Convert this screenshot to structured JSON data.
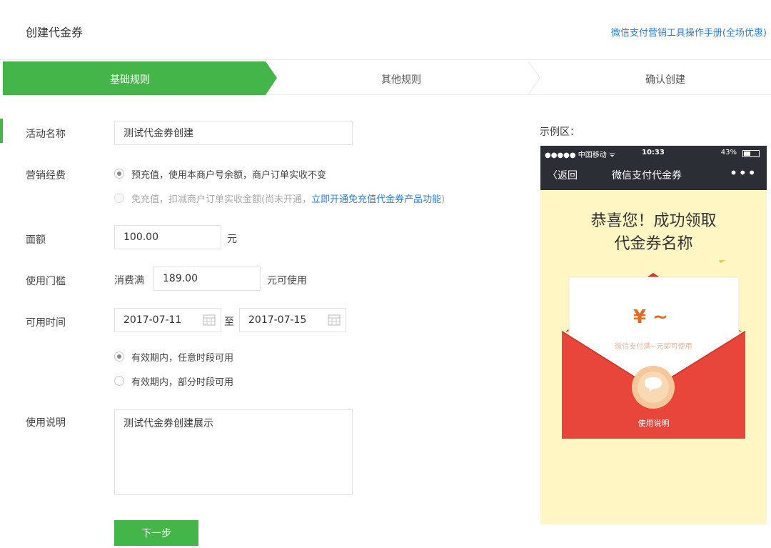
{
  "header": {
    "title": "创建代金券",
    "manual_link": "微信支付营销工具操作手册(全场优惠)"
  },
  "steps": [
    {
      "label": "基础规则",
      "active": true
    },
    {
      "label": "其他规则",
      "active": false
    },
    {
      "label": "确认创建",
      "active": false
    }
  ],
  "form": {
    "activity_name": {
      "label": "活动名称",
      "value": "测试代金券创建"
    },
    "marketing_fee": {
      "label": "营销经费",
      "option1": "预充值，使用本商户号余额，商户订单实收不变",
      "option2_prefix": "免充值，扣减商户订单实收金额(尚未开通，",
      "option2_link": "立即开通免充值代金券产品功能",
      "option2_suffix": ")"
    },
    "face_value": {
      "label": "面额",
      "value": "100.00",
      "unit": "元"
    },
    "threshold": {
      "label": "使用门槛",
      "prefix": "消费满",
      "value": "189.00",
      "suffix": "元可使用"
    },
    "available_time": {
      "label": "可用时间",
      "start": "2017-07-11",
      "to": "至",
      "end": "2017-07-15",
      "option1": "有效期内，任意时段可用",
      "option2": "有效期内，部分时段可用"
    },
    "instructions": {
      "label": "使用说明",
      "value": "测试代金券创建展示"
    },
    "next_button": "下一步"
  },
  "preview": {
    "label": "示例区：",
    "status_left": "●●●●● 中国移动 ᯤ",
    "status_time": "10:33",
    "status_right": "43%",
    "battery_level": 0.43,
    "back": "〈返回",
    "title": "微信支付代金券",
    "more": "•••",
    "congrats_line1": "恭喜您！成功领取",
    "congrats_line2": "代金券名称",
    "amount": "¥ ~",
    "desc": "微信支付满~元即可使用",
    "use_instructions": "使用说明"
  },
  "colors": {
    "accent": "#44b549",
    "link": "#2f7fd1",
    "envelope_red": "#e8463a",
    "preview_bg": "#fff6c4"
  }
}
